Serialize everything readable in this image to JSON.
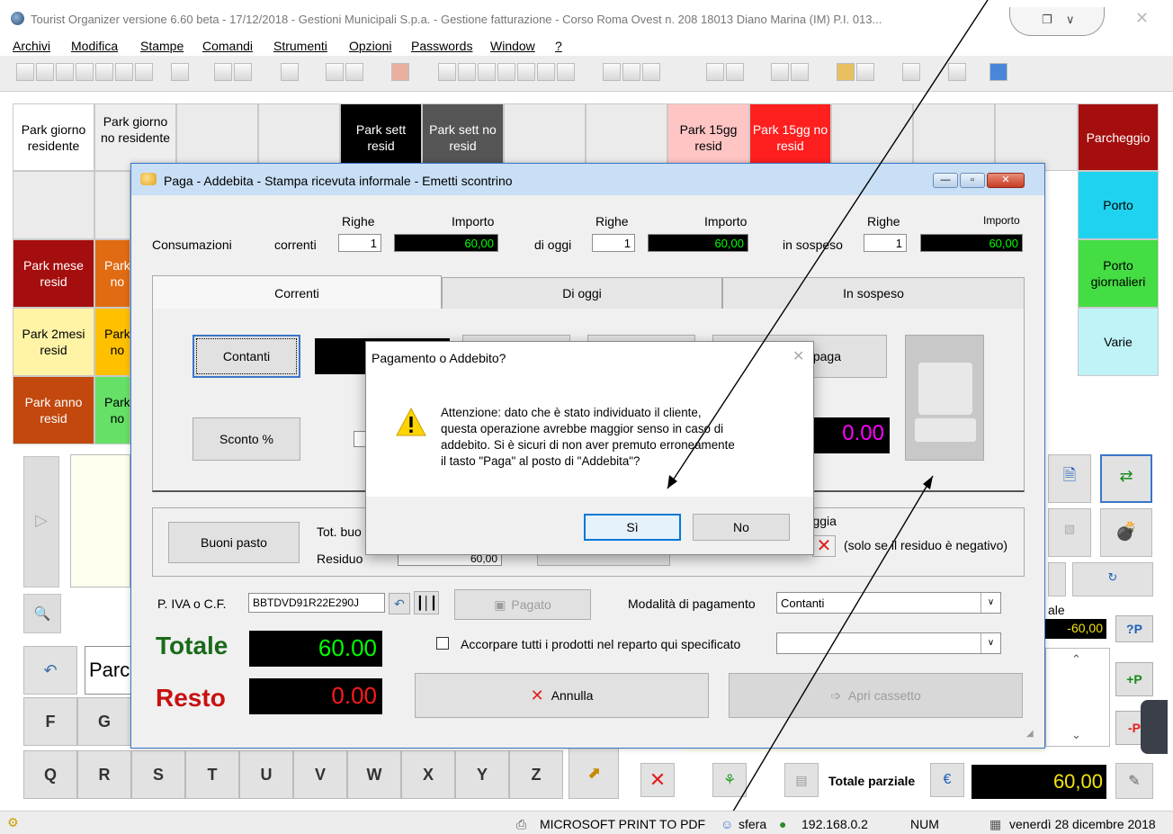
{
  "window": {
    "title": "Tourist Organizer versione 6.60 beta - 17/12/2018 - Gestioni Municipali S.p.a. - Gestione fatturazione -  Corso Roma Ovest n. 208  18013  Diano Marina (IM)  P.I. 013...",
    "tab_icons": [
      "restore-icon",
      "chevron-down-icon"
    ],
    "close_glyph": "✕"
  },
  "menu": [
    "Archivi",
    "Modifica",
    "Stampe",
    "Comandi",
    "Strumenti",
    "Opzioni",
    "Passwords",
    "Window",
    "?"
  ],
  "categories": {
    "park_giorno_res": "Park giorno residente",
    "park_giorno_nores": "Park giorno no residente",
    "park_sett_res": "Park sett resid",
    "park_sett_nores": "Park sett no resid",
    "park_15_res": "Park 15gg resid",
    "park_15_nores": "Park 15gg no resid",
    "parcheggio": "Parcheggio",
    "porto": "Porto",
    "park_mese_res": "Park mese resid",
    "park_mese_nores_short": "Park no",
    "porto_giornalieri": "Porto giornalieri",
    "park_2mesi_res": "Park 2mesi resid",
    "park_2mesi_nores_short": "Park no",
    "varie": "Varie",
    "park_anno_res": "Park anno resid",
    "park_anno_nores_short": "Park no"
  },
  "keyboard": {
    "row1": [
      "F",
      "G"
    ],
    "row2": [
      "Q",
      "R",
      "S",
      "T",
      "U",
      "V",
      "W",
      "X",
      "Y",
      "Z"
    ],
    "input_text": "Parc"
  },
  "right_panel": {
    "partial_label": "ale",
    "partial_value": "-60,00",
    "price_button": "?P",
    "plus_price": "+P",
    "minus_price": "-P"
  },
  "bottom_bar": {
    "totale_parziale_label": "Totale parziale",
    "currency": "€",
    "totale_parziale_value": "60,00"
  },
  "dialog": {
    "title": "Paga - Addebita - Stampa ricevuta informale - Emetti scontrino",
    "consumazioni_label": "Consumazioni",
    "correnti_label": "correnti",
    "oggi_label": "di oggi",
    "sospeso_label": "in sospeso",
    "righe_label": "Righe",
    "importo_label": "Importo",
    "correnti_righe": "1",
    "correnti_importo": "60,00",
    "oggi_righe": "1",
    "oggi_importo": "60,00",
    "sospeso_righe": "1",
    "sospeso_importo": "60,00",
    "tabs": [
      "Correnti",
      "Di oggi",
      "In sospeso"
    ],
    "contanti_button": "Contanti",
    "paga_button_partial": "paga",
    "sconto_button": "Sconto %",
    "magenta_value": "0.00",
    "buoni_pasto_button": "Buoni pasto",
    "tot_buoni_label": "Tot. buo",
    "residuo_label": "Residuo",
    "residuo_value": "60,00",
    "arrotonda_label": "reggia",
    "residuo_note": "(solo se il residuo è negativo)",
    "piva_label": "P. IVA o C.F.",
    "piva_value": "BBTDVD91R22E290J",
    "pagato_button": "Pagato",
    "modalita_label": "Modalità di pagamento",
    "modalita_value": "Contanti",
    "totale_label": "Totale",
    "totale_value": "60.00",
    "resto_label": "Resto",
    "resto_value": "0.00",
    "accorpare_label": "Accorpare tutti i prodotti nel reparto qui specificato",
    "accorpare_value": "",
    "annulla_button": "Annulla",
    "apri_cassetto_button": "Apri cassetto"
  },
  "message_box": {
    "title": "Pagamento o Addebito?",
    "text_lines": [
      "Attenzione: dato che è stato individuato il cliente,",
      "questa operazione avrebbe maggior senso in caso di",
      "addebito. Si è sicuri di non aver premuto erroneamente",
      "il tasto \"Paga\" al posto di \"Addebita\"?"
    ],
    "yes_button": "Sì",
    "no_button": "No"
  },
  "statusbar": {
    "printer": "MICROSOFT PRINT TO PDF",
    "user": "sfera",
    "ip": "192.168.0.2",
    "num": "NUM",
    "date": "venerdì 28 dicembre 2018"
  },
  "colors": {
    "dark_red": "#a50e0e",
    "orange": "#e06b12",
    "green": "#44dd44",
    "cyan": "#1fd3f0",
    "light_cyan": "#bff3f8",
    "pink": "#ffc5c5",
    "red": "#ff1f1f",
    "yellow_light": "#fff4a6",
    "magenta": "#ff00ff",
    "lime": "#00ff00"
  }
}
